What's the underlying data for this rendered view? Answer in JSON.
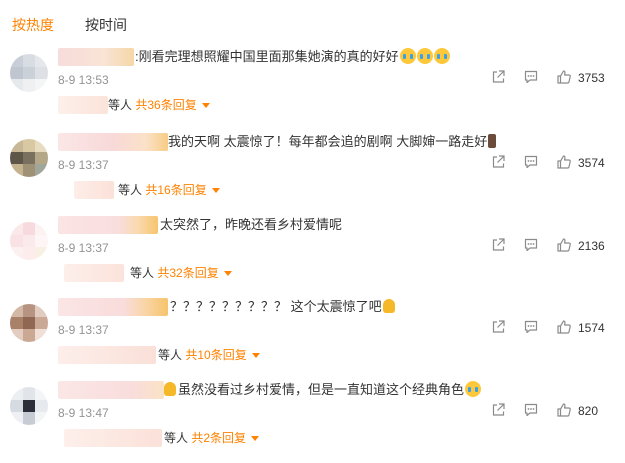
{
  "tabs": {
    "hot": "按热度",
    "time": "按时间"
  },
  "comments": [
    {
      "text": ":刚看完理想照耀中国里面那集她演的真的好好",
      "emojis": [
        "emoji-crying",
        "emoji-crying",
        "emoji-crying"
      ],
      "time": "8-9 13:53",
      "likes": "3753",
      "reply_prefix": "等人",
      "reply_link": "共36条回复"
    },
    {
      "text": "我的天啊 太震惊了！每年都会追的剧啊 大脚婶一路走好",
      "emojis": [
        "emoji-candle"
      ],
      "time": "8-9 13:37",
      "likes": "3574",
      "reply_prefix": "等人",
      "reply_link": "共16条回复"
    },
    {
      "text": "太突然了，昨晚还看乡村爱情呢",
      "emojis": [],
      "time": "8-9 13:37",
      "likes": "2136",
      "reply_prefix": "等人",
      "reply_link": "共32条回复"
    },
    {
      "text": "？？？？？？？？？ 这个太震惊了吧",
      "emojis": [
        "emoji-shocked"
      ],
      "time": "8-9 13:37",
      "likes": "1574",
      "reply_prefix": "等人",
      "reply_link": "共10条回复"
    },
    {
      "text": "虽然没看过乡村爱情，但是一直知道这个经典角色",
      "emojis": [
        "emoji-crying"
      ],
      "time": "8-9 13:47",
      "likes": "820",
      "reply_prefix": "等人",
      "reply_link": "共2条回复"
    }
  ],
  "colors": {
    "accent": "#ff8200",
    "text": "#333333",
    "muted": "#939393",
    "icon": "#8a8a8a"
  },
  "icons": {
    "share": "share-icon",
    "reply": "reply-icon",
    "like": "thumbs-up-icon",
    "caret": "caret-down-icon"
  }
}
